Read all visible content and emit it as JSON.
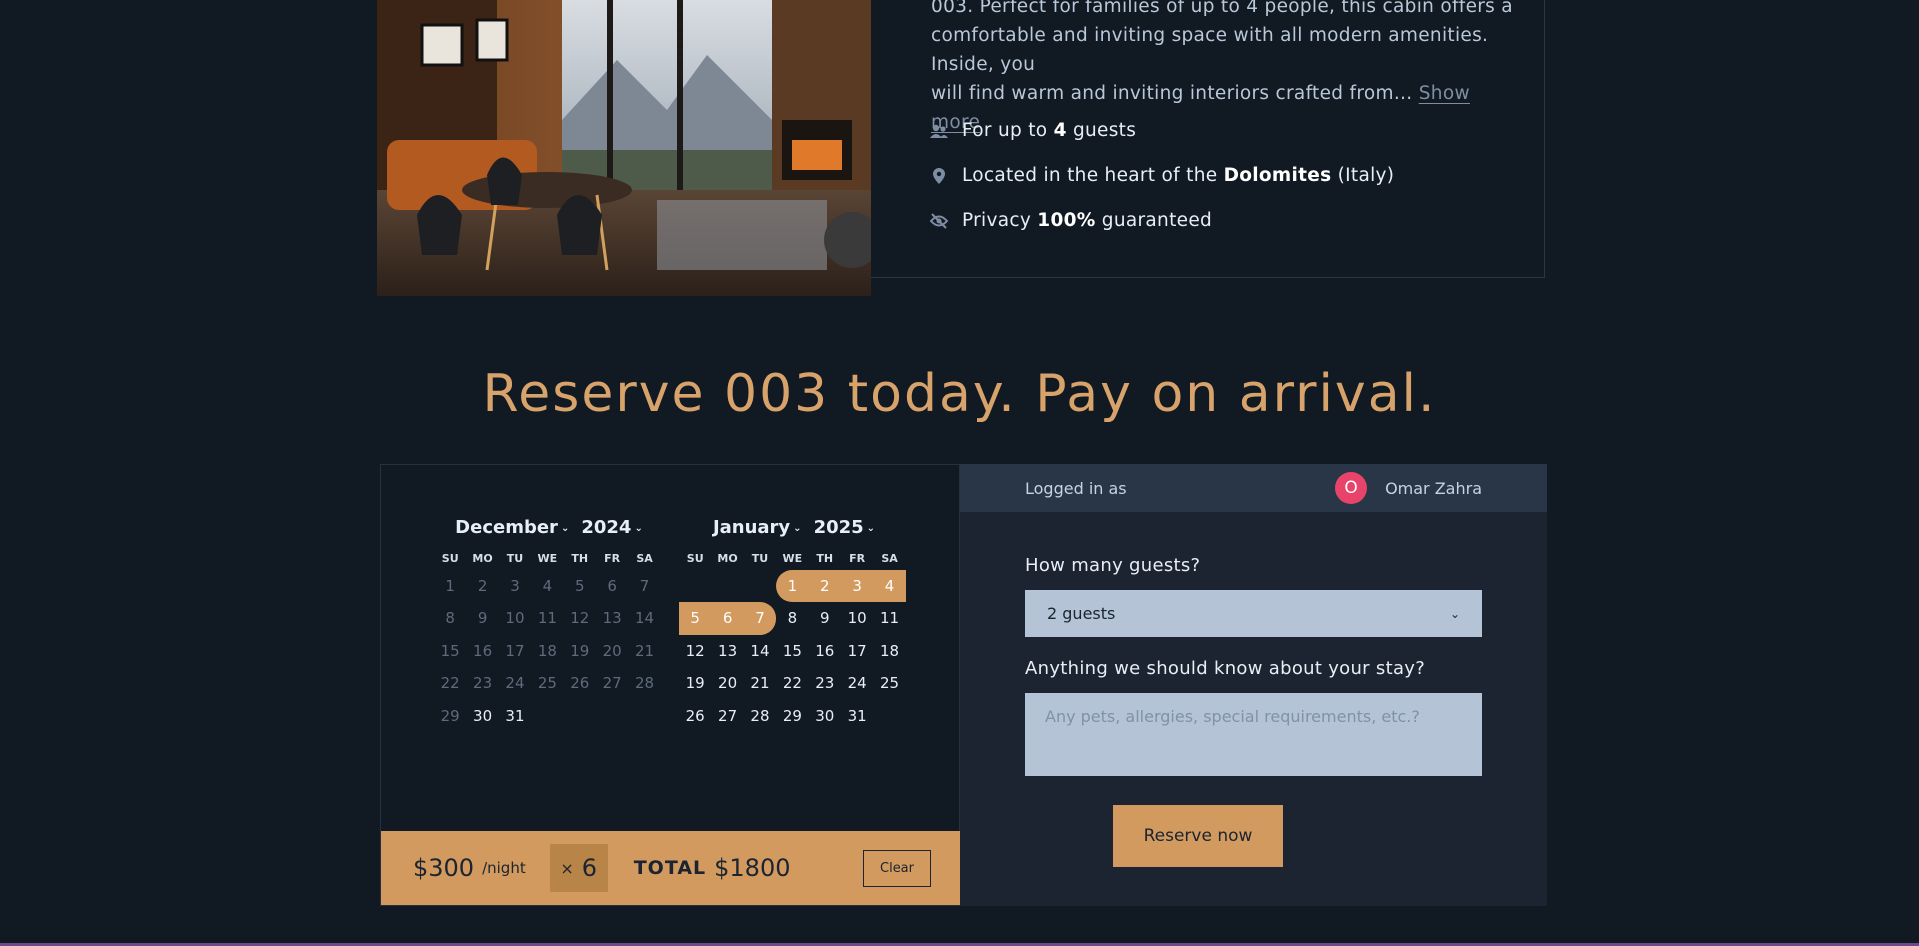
{
  "listing": {
    "description_line1": "003. Perfect for families of up to 4 people, this cabin offers a",
    "description_line2": "comfortable and inviting space with all modern amenities. Inside, you",
    "description_line3": "will find warm and inviting interiors crafted from…",
    "show_more": "Show more",
    "features": [
      {
        "icon": "users-icon",
        "prefix": "For up to ",
        "bold": "4",
        "suffix": " guests"
      },
      {
        "icon": "location-pin-icon",
        "prefix": "Located in the heart of the ",
        "bold": "Dolomites",
        "suffix": " (Italy)"
      },
      {
        "icon": "eye-off-icon",
        "prefix": "Privacy ",
        "bold": "100%",
        "suffix": " guaranteed"
      }
    ]
  },
  "headline": "Reserve 003 today. Pay on arrival.",
  "calendar": {
    "weekdays": [
      "SU",
      "MO",
      "TU",
      "WE",
      "TH",
      "FR",
      "SA"
    ],
    "months": [
      {
        "month": "December",
        "year": "2024",
        "weeks": [
          [
            "1",
            "2",
            "3",
            "4",
            "5",
            "6",
            "7"
          ],
          [
            "8",
            "9",
            "10",
            "11",
            "12",
            "13",
            "14"
          ],
          [
            "15",
            "16",
            "17",
            "18",
            "19",
            "20",
            "21"
          ],
          [
            "22",
            "23",
            "24",
            "25",
            "26",
            "27",
            "28"
          ],
          [
            "29",
            "30",
            "31",
            "",
            "",
            "",
            ""
          ]
        ]
      },
      {
        "month": "January",
        "year": "2025",
        "weeks": [
          [
            "",
            "",
            "",
            "1",
            "2",
            "3",
            "4"
          ],
          [
            "5",
            "6",
            "7",
            "8",
            "9",
            "10",
            "11"
          ],
          [
            "12",
            "13",
            "14",
            "15",
            "16",
            "17",
            "18"
          ],
          [
            "19",
            "20",
            "21",
            "22",
            "23",
            "24",
            "25"
          ],
          [
            "26",
            "27",
            "28",
            "29",
            "30",
            "31",
            ""
          ]
        ]
      }
    ],
    "past_until": "December 29",
    "selection": "January 1 – January 7"
  },
  "pricing": {
    "price": "$300",
    "per_night": "/night",
    "nights_symbol": "×",
    "nights": "6",
    "total_label": "TOTAL",
    "total_value": "$1800",
    "clear_label": "Clear"
  },
  "form": {
    "logged_in_label": "Logged in as",
    "avatar_initial": "O",
    "user_name": "Omar Zahra",
    "guests_label": "How many guests?",
    "guests_value": "2 guests",
    "notes_label": "Anything we should know about your stay?",
    "notes_placeholder": "Any pets, allergies, special requirements, etc.?",
    "reserve_label": "Reserve now"
  },
  "colors": {
    "background": "#111923",
    "accent": "#d29a5e",
    "panel": "#1b2430",
    "avatar": "#e8446b"
  }
}
